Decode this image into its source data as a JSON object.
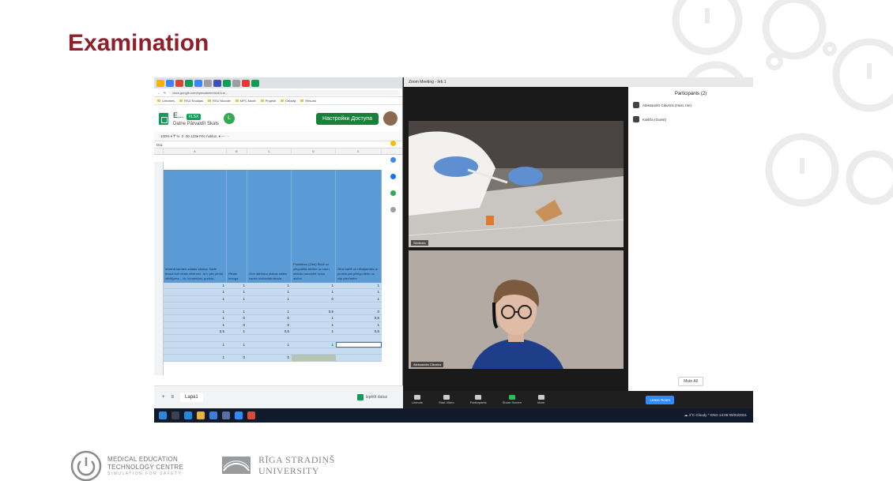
{
  "slide": {
    "title": "Examination",
    "accent_color": "#8f1f2a"
  },
  "browser": {
    "url": "docs.google.com/spreadsheets/d/1ue...",
    "bookmarks": [
      "Lietotnes",
      "RSU Studijas",
      "RSU Moodle",
      "MPC Mode",
      "Projekti",
      "Ceļotāji",
      "Resursi"
    ],
    "doc_title": "E...",
    "doc_badge": "XLSX",
    "doc_menu": "Datne  Pārvaldīt  Skats",
    "user_initial": "L",
    "share_button": "Настройки Доступа",
    "toolbar_text": "100%  ▾  ₸  %  .0  .00  123▾  Pēc noklus..▾  —  ···",
    "cell_ref": "D11",
    "columns": [
      "A",
      "B",
      "C",
      "D",
      "E"
    ],
    "header_cells": [
      "Ievainā karotes adatas vārdus: Kartē ievadi koli vilnas vēstnesi. Ja ir pēc pirmā vērtējuma... Nr. komentārs, punktu...",
      "Pilnas brauga",
      "Zem šķiršanu plakas saites karstu iznīcinātā tabula",
      "Punktāmu (Zīmi) Šķīdi un pieguldītā atzīme uz cauri sēdošu savukārt, koka atzīmi",
      "Otrai kartē un nēsājamāku ar punktu par pilnīgu tiešu un citu piezīmēm"
    ],
    "rows": [
      [
        "",
        "1",
        "1",
        "1",
        "1",
        "1"
      ],
      [
        "",
        "1",
        "1",
        "1",
        "1",
        "1"
      ],
      [
        "",
        "1",
        "1",
        "1",
        "0",
        "1"
      ],
      [
        "",
        "",
        "",
        "",
        "",
        ""
      ],
      [
        "",
        "1",
        "1",
        "1",
        "0,5",
        "0"
      ],
      [
        "",
        "1",
        "0",
        "0",
        "1",
        "0,5"
      ],
      [
        "",
        "1",
        "0",
        "0",
        "1",
        "1"
      ],
      [
        "",
        "0,5",
        "1",
        "0,5",
        "1",
        "0,5"
      ],
      [
        "",
        "",
        "",
        "",
        "",
        ""
      ],
      [
        "",
        "1",
        "1",
        "1",
        "1",
        ""
      ],
      [
        "",
        "",
        "",
        "",
        "",
        ""
      ],
      [
        "",
        "1",
        "0",
        "0",
        "",
        ""
      ]
    ],
    "sheet_tab": "Lapa1",
    "explore_label": "Izpētīt datus"
  },
  "zoom": {
    "window_title": "Zoom Meeting - Ieb.1",
    "view_label": "View",
    "cam1_label": "Simtesta",
    "cam2_label": "Aleksandrs Cikurins",
    "participants_title": "Participants (2)",
    "participants": [
      {
        "initials": "AC",
        "name": "Aleksandrs Cikurins (Host, me)"
      },
      {
        "initials": "K",
        "name": "Kalēža (Guest)"
      }
    ],
    "mute_all": "Mute All",
    "controls": [
      "Unmute",
      "Start Video",
      "Participants",
      "Share Screen",
      "More"
    ],
    "leave_button": "Leave Room"
  },
  "taskbar": {
    "tray_text": "☁ 4°C Cloudy  ^  ENG  14:05  09/03/2021"
  },
  "footer": {
    "mectc_line1": "MEDICAL EDUCATION",
    "mectc_line2": "TECHNOLOGY CENTRE",
    "mectc_tagline": "SIMULATION FOR SAFETY",
    "rsu_line1": "RĪGA STRADIŅŠ",
    "rsu_line2": "UNIVERSITY"
  }
}
